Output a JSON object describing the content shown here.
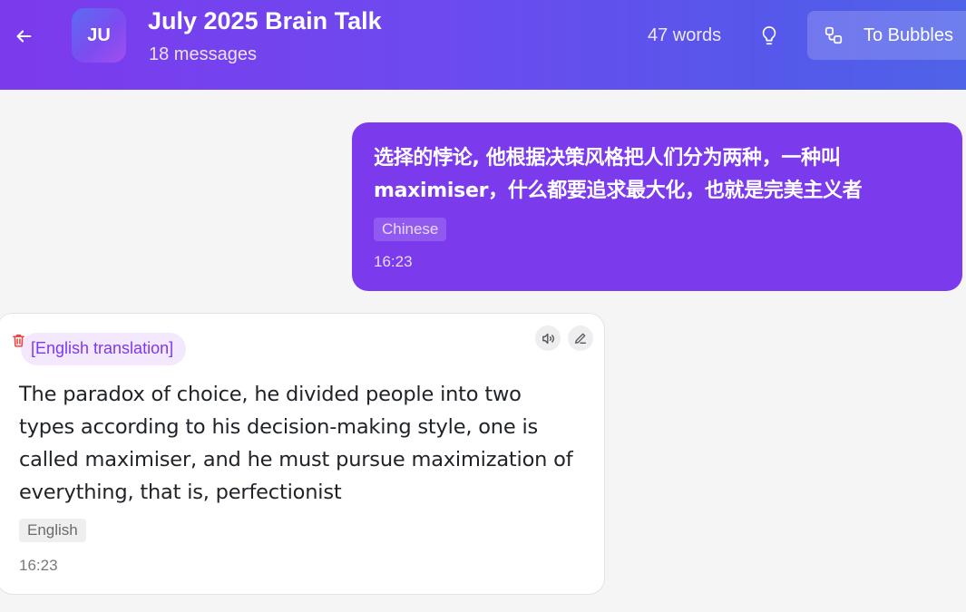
{
  "header": {
    "avatar_initials": "JU",
    "title": "July 2025 Brain Talk",
    "subtitle": "18 messages",
    "word_count": "47 words",
    "bubbles_button_label": "To Bubbles"
  },
  "messages": [
    {
      "role": "user",
      "text": "选择的悖论, 他根据决策风格把人们分为两种，一种叫maximiser，什么都要追求最大化，也就是完美主义者",
      "language": "Chinese",
      "time": "16:23"
    },
    {
      "role": "assistant",
      "tag": "[English translation]",
      "text": "The paradox of choice, he divided people into two types according to his decision-making style, one is called maximiser, and he must pursue maximization of everything, that is, perfectionist",
      "language": "English",
      "time": "16:23"
    }
  ],
  "icons": {
    "back": "arrow-left-icon",
    "bulb": "lightbulb-icon",
    "bubbles": "bubbles-icon",
    "delete": "trash-icon",
    "speak": "speaker-icon",
    "edit": "pencil-icon"
  },
  "colors": {
    "header_gradient_start": "#7c3aed",
    "header_gradient_end": "#4f63e8",
    "user_bubble": "#7c3aed",
    "translation_tag_bg": "#f3e8fd",
    "delete_icon": "#ef4444"
  }
}
